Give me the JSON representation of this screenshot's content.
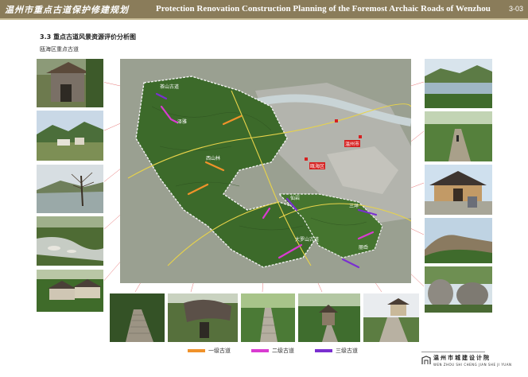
{
  "header": {
    "title_cn": "温州市重点古道保护修建规划",
    "title_en": "Protection Renovation Construction Planning of the Foremost Archaic Roads of  Wenzhou",
    "page_number": "3-03"
  },
  "section": {
    "title": "3.3  重点古道风景资源评价分析图",
    "subtitle": "瓯海区重点古道"
  },
  "map": {
    "labels": [
      {
        "text": "茶山古道",
        "style": "plain"
      },
      {
        "text": "泽雅",
        "style": "plain"
      },
      {
        "text": "西山林",
        "style": "plain"
      },
      {
        "text": "温州市",
        "style": "city"
      },
      {
        "text": "瓯海区",
        "style": "city"
      },
      {
        "text": "仙岩",
        "style": "plain"
      },
      {
        "text": "大罗山古道",
        "style": "plain"
      },
      {
        "text": "三垟",
        "style": "plain"
      },
      {
        "text": "丽岙",
        "style": "plain"
      }
    ]
  },
  "legend": {
    "items": [
      {
        "label": "一级古道",
        "color": "#f0922a"
      },
      {
        "label": "二级古道",
        "color": "#d93bd1"
      },
      {
        "label": "三级古道",
        "color": "#7a2fd0"
      }
    ]
  },
  "footer": {
    "org_name": "温州市城建设计院",
    "org_pinyin": "WEN ZHOU SHI CHENG JIAN SHE JI YUAN"
  }
}
